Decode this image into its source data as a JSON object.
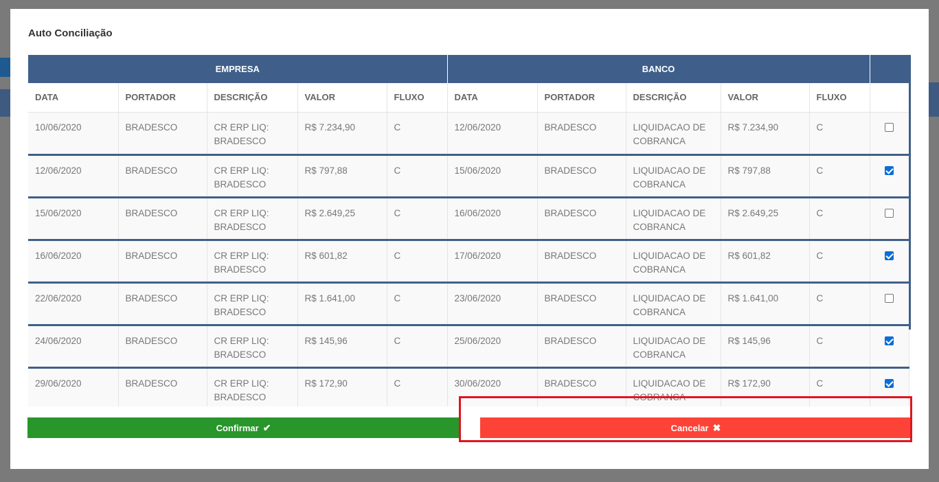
{
  "modal": {
    "title": "Auto Conciliação"
  },
  "table": {
    "group_headers": {
      "empresa": "EMPRESA",
      "banco": "BANCO"
    },
    "columns": [
      "DATA",
      "PORTADOR",
      "DESCRIÇÃO",
      "VALOR",
      "FLUXO",
      "DATA",
      "PORTADOR",
      "DESCRIÇÃO",
      "VALOR",
      "FLUXO"
    ],
    "rows": [
      {
        "e_data": "10/06/2020",
        "e_portador": "BRADESCO",
        "e_desc": "CR ERP LIQ: BRADESCO",
        "e_valor": "R$ 7.234,90",
        "e_fluxo": "C",
        "b_data": "12/06/2020",
        "b_portador": "BRADESCO",
        "b_desc": "LIQUIDACAO DE COBRANCA",
        "b_valor": "R$ 7.234,90",
        "b_fluxo": "C",
        "checked": false
      },
      {
        "e_data": "12/06/2020",
        "e_portador": "BRADESCO",
        "e_desc": "CR ERP LIQ: BRADESCO",
        "e_valor": "R$ 797,88",
        "e_fluxo": "C",
        "b_data": "15/06/2020",
        "b_portador": "BRADESCO",
        "b_desc": "LIQUIDACAO DE COBRANCA",
        "b_valor": "R$ 797,88",
        "b_fluxo": "C",
        "checked": true
      },
      {
        "e_data": "15/06/2020",
        "e_portador": "BRADESCO",
        "e_desc": "CR ERP LIQ: BRADESCO",
        "e_valor": "R$ 2.649,25",
        "e_fluxo": "C",
        "b_data": "16/06/2020",
        "b_portador": "BRADESCO",
        "b_desc": "LIQUIDACAO DE COBRANCA",
        "b_valor": "R$ 2.649,25",
        "b_fluxo": "C",
        "checked": false
      },
      {
        "e_data": "16/06/2020",
        "e_portador": "BRADESCO",
        "e_desc": "CR ERP LIQ: BRADESCO",
        "e_valor": "R$ 601,82",
        "e_fluxo": "C",
        "b_data": "17/06/2020",
        "b_portador": "BRADESCO",
        "b_desc": "LIQUIDACAO DE COBRANCA",
        "b_valor": "R$ 601,82",
        "b_fluxo": "C",
        "checked": true
      },
      {
        "e_data": "22/06/2020",
        "e_portador": "BRADESCO",
        "e_desc": "CR ERP LIQ: BRADESCO",
        "e_valor": "R$ 1.641,00",
        "e_fluxo": "C",
        "b_data": "23/06/2020",
        "b_portador": "BRADESCO",
        "b_desc": "LIQUIDACAO DE COBRANCA",
        "b_valor": "R$ 1.641,00",
        "b_fluxo": "C",
        "checked": false
      },
      {
        "e_data": "24/06/2020",
        "e_portador": "BRADESCO",
        "e_desc": "CR ERP LIQ: BRADESCO",
        "e_valor": "R$ 145,96",
        "e_fluxo": "C",
        "b_data": "25/06/2020",
        "b_portador": "BRADESCO",
        "b_desc": "LIQUIDACAO DE COBRANCA",
        "b_valor": "R$ 145,96",
        "b_fluxo": "C",
        "checked": true
      },
      {
        "e_data": "29/06/2020",
        "e_portador": "BRADESCO",
        "e_desc": "CR ERP LIQ: BRADESCO",
        "e_valor": "R$ 172,90",
        "e_fluxo": "C",
        "b_data": "30/06/2020",
        "b_portador": "BRADESCO",
        "b_desc": "LIQUIDACAO DE COBRANCA",
        "b_valor": "R$ 172,90",
        "b_fluxo": "C",
        "checked": true
      }
    ]
  },
  "buttons": {
    "confirm_label": "Confirmar",
    "confirm_icon": "check-icon",
    "cancel_label": "Cancelar",
    "cancel_icon": "close-icon"
  },
  "colors": {
    "header": "#3f5f8a",
    "confirm": "#28962b",
    "cancel": "#fd4337",
    "highlight": "#e0141e"
  }
}
